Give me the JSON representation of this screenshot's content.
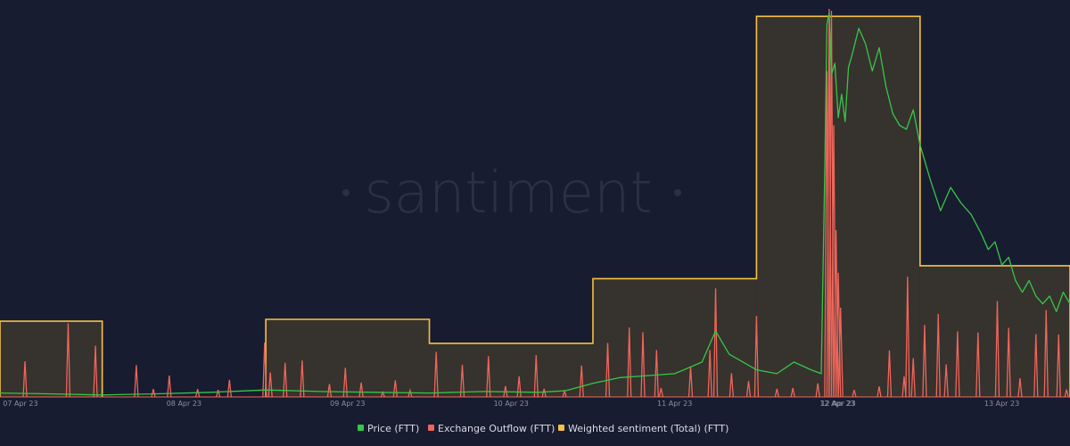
{
  "watermark": "santiment",
  "colors": {
    "background": "#181c30",
    "price": "#35c747",
    "outflow": "#f0655a",
    "sentiment": "#f6c244",
    "sentiment_fill": "#3a352f",
    "tick": "#8a8fa3"
  },
  "legend": [
    {
      "label": "Price (FTT)",
      "color": "#35c747"
    },
    {
      "label": "Exchange Outflow (FTT)",
      "color": "#f0655a"
    },
    {
      "label": "Weighted sentiment (Total) (FTT)",
      "color": "#f6c244"
    }
  ],
  "chart_data": {
    "type": "line",
    "title": "",
    "xlabel": "",
    "ylabel": "",
    "grid": false,
    "legend_position": "bottom",
    "x_range": [
      "2023-04-07T09:00",
      "2023-04-13T22:00"
    ],
    "x_ticks": [
      {
        "t": "2023-04-07T12:00",
        "label": "07 Apr 23"
      },
      {
        "t": "2023-04-08T12:00",
        "label": "08 Apr 23"
      },
      {
        "t": "2023-04-09T12:00",
        "label": "09 Apr 23"
      },
      {
        "t": "2023-04-10T12:00",
        "label": "10 Apr 23"
      },
      {
        "t": "2023-04-11T12:00",
        "label": "11 Apr 23"
      },
      {
        "t": "2023-04-12T12:00",
        "label": "12 Apr 23"
      },
      {
        "t": "2023-04-12T12:00",
        "label": "12 Apr 23"
      },
      {
        "t": "2023-04-13T12:00",
        "label": "13 Apr 23"
      }
    ],
    "series": [
      {
        "name": "Weighted sentiment (Total) (FTT)",
        "kind": "step",
        "axis_max": 4.2,
        "steps": [
          {
            "start": "2023-04-07T09:00",
            "end": "2023-04-08T00:00",
            "value": 0.82
          },
          {
            "start": "2023-04-09T00:00",
            "end": "2023-04-10T00:00",
            "value": 0.84
          },
          {
            "start": "2023-04-10T00:00",
            "end": "2023-04-11T00:00",
            "value": 0.58
          },
          {
            "start": "2023-04-11T00:00",
            "end": "2023-04-12T00:00",
            "value": 1.28
          },
          {
            "start": "2023-04-12T00:00",
            "end": "2023-04-13T00:00",
            "value": 4.12
          },
          {
            "start": "2023-04-13T00:00",
            "end": "2023-04-14T00:00",
            "value": 1.42
          }
        ]
      },
      {
        "name": "Exchange Outflow (FTT)",
        "kind": "spikes",
        "axis_max": 1000,
        "spikes": [
          [
            "2023-04-07T12:40",
            92
          ],
          [
            "2023-04-07T19:00",
            190
          ],
          [
            "2023-04-07T23:00",
            132
          ],
          [
            "2023-04-08T05:00",
            82
          ],
          [
            "2023-04-08T07:30",
            20
          ],
          [
            "2023-04-08T09:50",
            55
          ],
          [
            "2023-04-08T14:00",
            20
          ],
          [
            "2023-04-08T17:00",
            18
          ],
          [
            "2023-04-08T18:40",
            44
          ],
          [
            "2023-04-08T23:50",
            140
          ],
          [
            "2023-04-09T00:40",
            63
          ],
          [
            "2023-04-09T02:50",
            88
          ],
          [
            "2023-04-09T05:20",
            94
          ],
          [
            "2023-04-09T09:20",
            33
          ],
          [
            "2023-04-09T11:40",
            75
          ],
          [
            "2023-04-09T14:00",
            37
          ],
          [
            "2023-04-09T17:10",
            12
          ],
          [
            "2023-04-09T19:00",
            43
          ],
          [
            "2023-04-09T21:10",
            17
          ],
          [
            "2023-04-10T01:00",
            116
          ],
          [
            "2023-04-10T04:50",
            83
          ],
          [
            "2023-04-10T08:40",
            105
          ],
          [
            "2023-04-10T11:10",
            28
          ],
          [
            "2023-04-10T13:10",
            53
          ],
          [
            "2023-04-10T15:40",
            108
          ],
          [
            "2023-04-10T16:50",
            21
          ],
          [
            "2023-04-10T19:50",
            15
          ],
          [
            "2023-04-10T22:20",
            81
          ],
          [
            "2023-04-11T02:10",
            139
          ],
          [
            "2023-04-11T05:20",
            179
          ],
          [
            "2023-04-11T07:20",
            167
          ],
          [
            "2023-04-11T09:20",
            121
          ],
          [
            "2023-04-11T10:00",
            23
          ],
          [
            "2023-04-11T14:20",
            78
          ],
          [
            "2023-04-11T17:10",
            121
          ],
          [
            "2023-04-11T18:00",
            280
          ],
          [
            "2023-04-11T20:20",
            61
          ],
          [
            "2023-04-11T22:50",
            41
          ],
          [
            "2023-04-12T00:00",
            209
          ],
          [
            "2023-04-12T03:00",
            21
          ],
          [
            "2023-04-12T05:20",
            23
          ],
          [
            "2023-04-12T09:00",
            35
          ],
          [
            "2023-04-12T14:20",
            18
          ],
          [
            "2023-04-12T18:00",
            27
          ],
          [
            "2023-04-12T19:30",
            120
          ],
          [
            "2023-04-12T21:40",
            53
          ],
          [
            "2023-04-12T22:10",
            310
          ],
          [
            "2023-04-12T23:00",
            100
          ],
          [
            "2023-04-13T00:40",
            186
          ],
          [
            "2023-04-13T02:40",
            214
          ],
          [
            "2023-04-13T03:50",
            84
          ],
          [
            "2023-04-13T05:30",
            169
          ],
          [
            "2023-04-13T08:30",
            166
          ],
          [
            "2023-04-13T11:20",
            247
          ],
          [
            "2023-04-13T13:00",
            178
          ],
          [
            "2023-04-13T14:40",
            48
          ],
          [
            "2023-04-13T17:00",
            162
          ],
          [
            "2023-04-13T18:30",
            224
          ],
          [
            "2023-04-13T20:20",
            161
          ],
          [
            "2023-04-13T21:30",
            19
          ]
        ],
        "spike_burst": [
          [
            "2023-04-12T10:20",
            840
          ],
          [
            "2023-04-12T10:40",
            1000
          ],
          [
            "2023-04-12T11:00",
            995
          ],
          [
            "2023-04-12T11:20",
            700
          ],
          [
            "2023-04-12T11:40",
            430
          ],
          [
            "2023-04-12T12:00",
            320
          ],
          [
            "2023-04-12T12:20",
            230
          ]
        ]
      },
      {
        "name": "Price (FTT)",
        "kind": "line",
        "axis_max": 1,
        "points": [
          [
            "2023-04-07T09:00",
            0.01
          ],
          [
            "2023-04-07T16:00",
            0.008
          ],
          [
            "2023-04-08T00:00",
            0.005
          ],
          [
            "2023-04-08T08:00",
            0.008
          ],
          [
            "2023-04-08T16:00",
            0.012
          ],
          [
            "2023-04-09T00:00",
            0.018
          ],
          [
            "2023-04-09T08:00",
            0.014
          ],
          [
            "2023-04-09T16:00",
            0.012
          ],
          [
            "2023-04-10T00:00",
            0.01
          ],
          [
            "2023-04-10T08:00",
            0.014
          ],
          [
            "2023-04-10T16:00",
            0.012
          ],
          [
            "2023-04-10T20:00",
            0.016
          ],
          [
            "2023-04-11T00:00",
            0.035
          ],
          [
            "2023-04-11T04:00",
            0.05
          ],
          [
            "2023-04-11T08:00",
            0.055
          ],
          [
            "2023-04-11T12:00",
            0.06
          ],
          [
            "2023-04-11T16:00",
            0.09
          ],
          [
            "2023-04-11T18:00",
            0.17
          ],
          [
            "2023-04-11T20:00",
            0.11
          ],
          [
            "2023-04-12T00:00",
            0.07
          ],
          [
            "2023-04-12T03:00",
            0.06
          ],
          [
            "2023-04-12T05:30",
            0.09
          ],
          [
            "2023-04-12T08:00",
            0.07
          ],
          [
            "2023-04-12T09:30",
            0.06
          ],
          [
            "2023-04-12T10:00",
            0.56
          ],
          [
            "2023-04-12T10:20",
            0.96
          ],
          [
            "2023-04-12T10:40",
            0.99
          ],
          [
            "2023-04-12T11:00",
            0.83
          ],
          [
            "2023-04-12T11:30",
            0.86
          ],
          [
            "2023-04-12T12:00",
            0.72
          ],
          [
            "2023-04-12T12:30",
            0.78
          ],
          [
            "2023-04-12T13:00",
            0.71
          ],
          [
            "2023-04-12T13:30",
            0.85
          ],
          [
            "2023-04-12T14:00",
            0.88
          ],
          [
            "2023-04-12T15:00",
            0.95
          ],
          [
            "2023-04-12T16:00",
            0.91
          ],
          [
            "2023-04-12T17:00",
            0.84
          ],
          [
            "2023-04-12T18:00",
            0.9
          ],
          [
            "2023-04-12T19:00",
            0.8
          ],
          [
            "2023-04-12T20:00",
            0.73
          ],
          [
            "2023-04-12T21:00",
            0.7
          ],
          [
            "2023-04-12T22:00",
            0.69
          ],
          [
            "2023-04-12T23:00",
            0.74
          ],
          [
            "2023-04-13T00:00",
            0.65
          ],
          [
            "2023-04-13T01:30",
            0.56
          ],
          [
            "2023-04-13T03:00",
            0.48
          ],
          [
            "2023-04-13T04:30",
            0.54
          ],
          [
            "2023-04-13T06:00",
            0.5
          ],
          [
            "2023-04-13T07:30",
            0.47
          ],
          [
            "2023-04-13T09:00",
            0.42
          ],
          [
            "2023-04-13T10:00",
            0.38
          ],
          [
            "2023-04-13T11:00",
            0.4
          ],
          [
            "2023-04-13T12:00",
            0.34
          ],
          [
            "2023-04-13T13:00",
            0.36
          ],
          [
            "2023-04-13T14:00",
            0.3
          ],
          [
            "2023-04-13T15:00",
            0.27
          ],
          [
            "2023-04-13T16:00",
            0.3
          ],
          [
            "2023-04-13T17:00",
            0.26
          ],
          [
            "2023-04-13T18:00",
            0.24
          ],
          [
            "2023-04-13T19:00",
            0.26
          ],
          [
            "2023-04-13T20:00",
            0.22
          ],
          [
            "2023-04-13T21:00",
            0.27
          ],
          [
            "2023-04-13T22:00",
            0.24
          ]
        ]
      }
    ]
  }
}
